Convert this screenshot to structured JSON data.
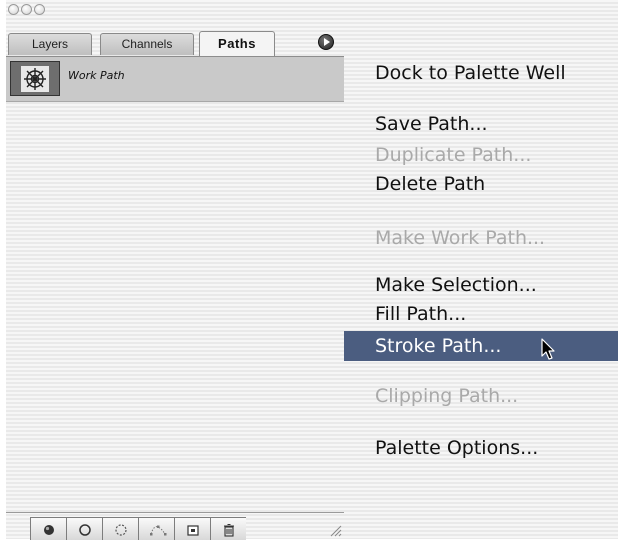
{
  "palette": {
    "tabs": [
      {
        "label": "Layers",
        "active": false
      },
      {
        "label": "Channels",
        "active": false
      },
      {
        "label": "Paths",
        "active": true
      }
    ],
    "paths": [
      {
        "name": "Work Path",
        "selected": true
      }
    ],
    "bottom_buttons": [
      {
        "icon": "fill-path-icon"
      },
      {
        "icon": "stroke-path-icon"
      },
      {
        "icon": "load-selection-icon"
      },
      {
        "icon": "make-work-path-icon"
      },
      {
        "icon": "new-path-icon"
      },
      {
        "icon": "trash-icon"
      }
    ]
  },
  "menu": {
    "items": [
      {
        "label": "Dock to Palette Well",
        "enabled": true
      },
      {
        "label": "Save Path...",
        "enabled": true
      },
      {
        "label": "Duplicate Path...",
        "enabled": false
      },
      {
        "label": "Delete Path",
        "enabled": true
      },
      {
        "label": "Make Work Path...",
        "enabled": false
      },
      {
        "label": "Make Selection...",
        "enabled": true
      },
      {
        "label": "Fill Path...",
        "enabled": true
      },
      {
        "label": "Stroke Path...",
        "enabled": true,
        "highlighted": true
      },
      {
        "label": "Clipping Path...",
        "enabled": false
      },
      {
        "label": "Palette Options...",
        "enabled": true
      }
    ]
  },
  "colors": {
    "menu_highlight": "#4b5d80",
    "disabled_text": "#a9a9a9",
    "row_selected": "#c9c9c9"
  }
}
